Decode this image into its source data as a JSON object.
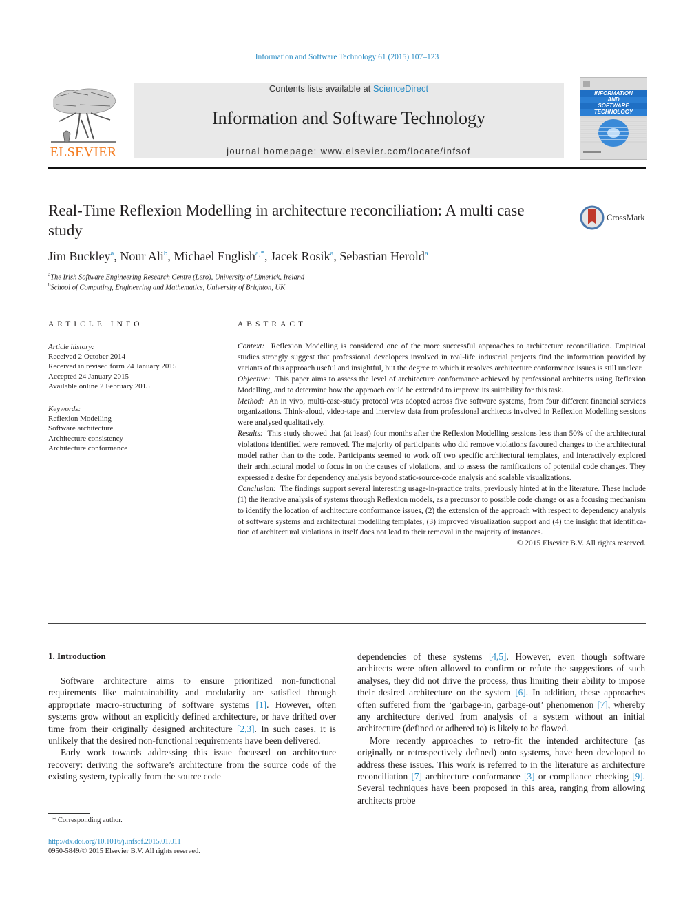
{
  "header": {
    "journal_ref": "Information and Software Technology 61 (2015) 107–123",
    "contents_prefix": "Contents lists available at ",
    "contents_link": "ScienceDirect",
    "journal_name": "Information and Software Technology",
    "homepage": "journal homepage: www.elsevier.com/locate/infsof",
    "publisher_logo_text": "ELSEVIER",
    "cover_title_lines": [
      "INFORMATION",
      "AND",
      "SOFTWARE",
      "TECHNOLOGY"
    ],
    "crossmark_label": "CrossMark",
    "colors": {
      "link": "#2a8cc4",
      "elsevier_orange": "#f47c20",
      "cover_blue": "#1f6fc4"
    }
  },
  "article": {
    "title": "Real-Time Reflexion Modelling in architecture reconciliation: A multi case study",
    "authors": [
      {
        "name": "Jim Buckley",
        "sup": "a"
      },
      {
        "name": "Nour Ali",
        "sup": "b"
      },
      {
        "name": "Michael English",
        "sup": "a,*"
      },
      {
        "name": "Jacek Rosik",
        "sup": "a"
      },
      {
        "name": "Sebastian Herold",
        "sup": "a"
      }
    ],
    "affiliations": [
      {
        "sup": "a",
        "text": "The Irish Software Engineering Research Centre (Lero), University of Limerick, Ireland"
      },
      {
        "sup": "b",
        "text": "School of Computing, Engineering and Mathematics, University of Brighton, UK"
      }
    ]
  },
  "article_info": {
    "heading": "ARTICLE INFO",
    "history_label": "Article history:",
    "history": [
      "Received 2 October 2014",
      "Received in revised form 24 January 2015",
      "Accepted 24 January 2015",
      "Available online 2 February 2015"
    ],
    "keywords_label": "Keywords:",
    "keywords": [
      "Reflexion Modelling",
      "Software architecture",
      "Architecture consistency",
      "Architecture conformance"
    ]
  },
  "abstract": {
    "heading": "ABSTRACT",
    "sections": [
      {
        "label": "Context:",
        "text": "Reflexion Modelling is considered one of the more successful approaches to architecture recon­ciliation. Empirical studies strongly suggest that professional developers involved in real-life industrial projects find the information provided by variants of this approach useful and insightful, but the degree to which it resolves architecture conformance issues is still unclear."
      },
      {
        "label": "Objective:",
        "text": "This paper aims to assess the level of architecture conformance achieved by professional archi­tects using Reflexion Modelling, and to determine how the approach could be extended to improve its suitability for this task."
      },
      {
        "label": "Method:",
        "text": "An in vivo, multi-case-study protocol was adopted across five software systems, from four dif­ferent financial services organizations. Think-aloud, video-tape and interview data from professional architects involved in Reflexion Modelling sessions were analysed qualitatively."
      },
      {
        "label": "Results:",
        "text": "This study showed that (at least) four months after the Reflexion Modelling sessions less than 50% of the architectural violations identified were removed. The majority of participants who did remove violations favoured changes to the architectural model rather than to the code. Participants seemed to work off two specific architectural templates, and interactively explored their architectural model to focus in on the causes of violations, and to assess the ramifications of potential code changes. They expressed a desire for dependency analysis beyond static-source-code analysis and scalable visualiza­tions."
      },
      {
        "label": "Conclusion:",
        "text": "The findings support several interesting usage-in-practice traits, previously hinted at in the literature. These include (1) the iterative analysis of systems through Reflexion models, as a precursor to possible code change or as a focusing mechanism to identify the location of architecture conformance issues, (2) the extension of the approach with respect to dependency analysis of software systems and architectural modelling templates, (3) improved visualization support and (4) the insight that identifica­tion of architectural violations in itself does not lead to their removal in the majority of instances."
      }
    ],
    "copyright": "© 2015 Elsevier B.V. All rights reserved."
  },
  "body": {
    "section_heading": "1. Introduction",
    "left": {
      "p1_a": "Software architecture aims to ensure prioritized non-functional requirements like maintainability and modularity are satisfied through appropriate macro-structuring of software systems ",
      "p1_ref1": "[1]",
      "p1_b": ". However, often systems grow without an explicitly defined archi­tecture, or have drifted over time from their originally designed architecture ",
      "p1_ref2": "[2,3]",
      "p1_c": ". In such cases, it is unlikely that the desired non-functional requirements have been delivered.",
      "p2": "Early work towards addressing this issue focussed on architec­ture recovery: deriving the software’s architecture from the source code of the existing system, typically from the source code"
    },
    "right": {
      "p1_a": "dependencies of these systems ",
      "p1_ref1": "[4,5]",
      "p1_b": ". However, even though software architects were often allowed to confirm or refute the suggestions of such analyses, they did not drive the process, thus limiting their ability to impose their desired architecture on the system ",
      "p1_ref2": "[6]",
      "p1_c": ". In addition, these approaches often suffered from the ‘garbage-in, garbage-out’ phenomenon ",
      "p1_ref3": "[7]",
      "p1_d": ", whereby any architecture derived from analysis of a system without an initial architecture (defined or adhered to) is likely to be flawed.",
      "p2_a": "More recently approaches to retro-fit the intended architecture (as originally or retrospectively defined) onto systems, have been developed to address these issues. This work is referred to in the literature as architecture reconciliation ",
      "p2_ref1": "[7]",
      "p2_b": " architecture confor­mance ",
      "p2_ref2": "[3]",
      "p2_c": " or compliance checking ",
      "p2_ref3": "[9]",
      "p2_d": ". Several techniques have been proposed in this area, ranging from allowing architects probe"
    }
  },
  "footer": {
    "footnote": "* Corresponding author.",
    "doi": "http://dx.doi.org/10.1016/j.infsof.2015.01.011",
    "issn": "0950-5849/© 2015 Elsevier B.V. All rights reserved."
  }
}
